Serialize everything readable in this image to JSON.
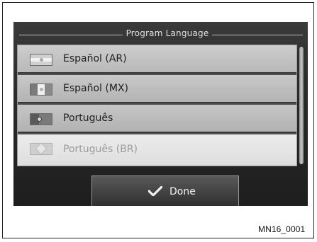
{
  "dialog": {
    "title": "Program Language"
  },
  "languages": [
    {
      "label": "Español (AR)",
      "flag_icon": "argentina-flag-icon",
      "state": "normal"
    },
    {
      "label": "Español (MX)",
      "flag_icon": "mexico-flag-icon",
      "state": "normal"
    },
    {
      "label": "Português",
      "flag_icon": "portugal-flag-icon",
      "state": "normal"
    },
    {
      "label": "Português (BR)",
      "flag_icon": "brazil-flag-icon",
      "state": "highlighted"
    }
  ],
  "actions": {
    "done_label": "Done",
    "done_icon": "checkmark-icon"
  },
  "figure": {
    "caption": "MN16_0001"
  }
}
